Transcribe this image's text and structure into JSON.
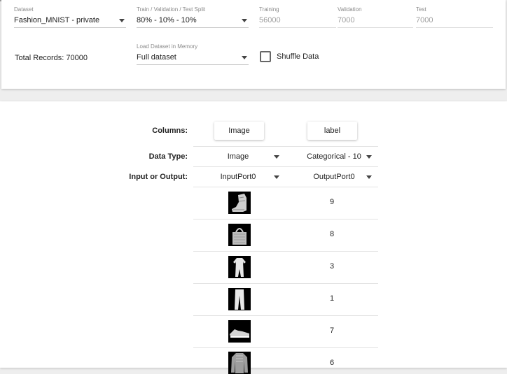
{
  "settings": {
    "dataset": {
      "label": "Dataset",
      "value": "Fashion_MNIST - private"
    },
    "split": {
      "label": "Train / Validation / Test Split",
      "value": "80% - 10% - 10%"
    },
    "training": {
      "label": "Training",
      "value": "56000"
    },
    "validation": {
      "label": "Validation",
      "value": "7000"
    },
    "test": {
      "label": "Test",
      "value": "7000"
    },
    "total_records": "Total Records: 70000",
    "load_memory": {
      "label": "Load Dataset in Memory",
      "value": "Full dataset"
    },
    "shuffle": {
      "label": "Shuffle Data",
      "checked": false
    }
  },
  "table": {
    "row_labels": {
      "columns": "Columns:",
      "data_type": "Data Type:",
      "io": "Input or Output:"
    },
    "columns": [
      {
        "name": "Image",
        "data_type": "Image",
        "io": "InputPort0"
      },
      {
        "name": "label",
        "data_type": "Categorical - 10",
        "io": "OutputPort0"
      }
    ],
    "rows": [
      {
        "image_icon": "ankle-boot-thumbnail-icon",
        "label": "9"
      },
      {
        "image_icon": "bag-thumbnail-icon",
        "label": "8"
      },
      {
        "image_icon": "dress-thumbnail-icon",
        "label": "3"
      },
      {
        "image_icon": "trouser-thumbnail-icon",
        "label": "1"
      },
      {
        "image_icon": "sneaker-thumbnail-icon",
        "label": "7"
      },
      {
        "image_icon": "shirt-thumbnail-icon",
        "label": "6"
      }
    ]
  },
  "colors": {
    "caret": "#444444",
    "divider": "#e3e3e3",
    "muted_text": "#9e9e9e",
    "label_text": "#8a8a8a"
  }
}
